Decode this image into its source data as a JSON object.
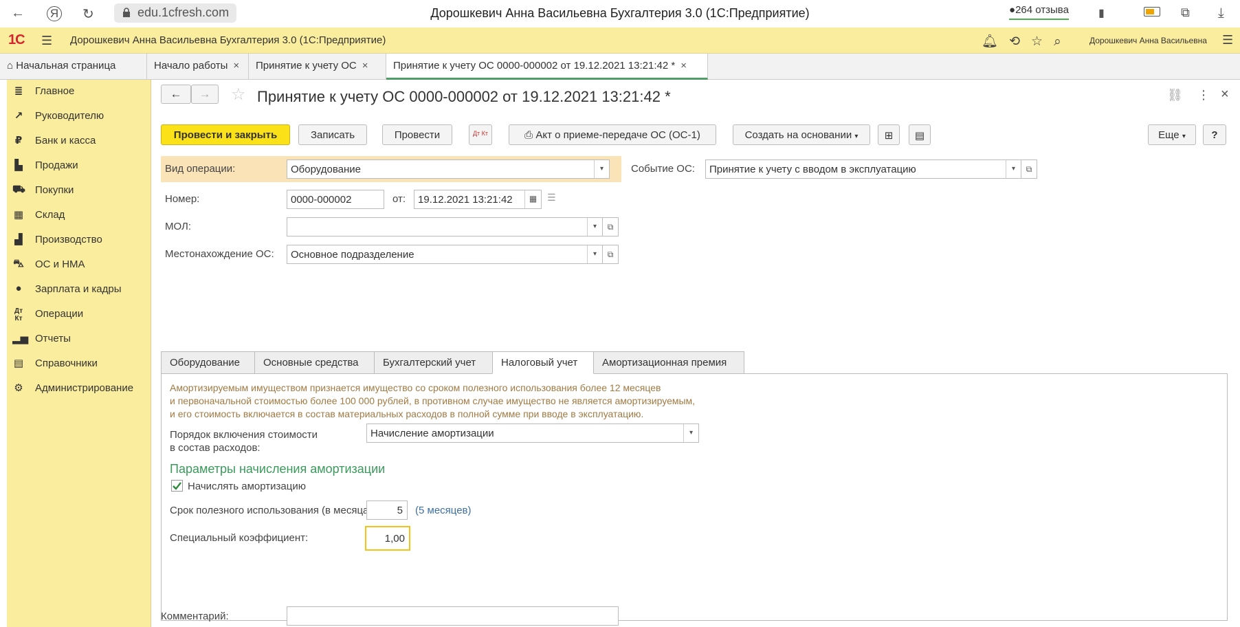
{
  "browser": {
    "url": "edu.1cfresh.com",
    "title": "Дорошкевич Анна Васильевна Бухгалтерия 3.0 (1С:Предприятие)",
    "reviews": "264 отзыва"
  },
  "app": {
    "logo": "1С",
    "title": "Дорошкевич Анна Васильевна Бухгалтерия 3.0  (1С:Предприятие)",
    "user": "Дорошкевич Анна Васильевна"
  },
  "tabs": [
    {
      "label": "Начальная страница"
    },
    {
      "label": "Начало работы"
    },
    {
      "label": "Принятие к учету ОС"
    },
    {
      "label": "Принятие к учету ОС 0000-000002 от 19.12.2021 13:21:42 *"
    }
  ],
  "sidebar": {
    "items": [
      {
        "label": "Главное"
      },
      {
        "label": "Руководителю"
      },
      {
        "label": "Банк и касса"
      },
      {
        "label": "Продажи"
      },
      {
        "label": "Покупки"
      },
      {
        "label": "Склад"
      },
      {
        "label": "Производство"
      },
      {
        "label": "ОС и НМА"
      },
      {
        "label": "Зарплата и кадры"
      },
      {
        "label": "Операции"
      },
      {
        "label": "Отчеты"
      },
      {
        "label": "Справочники"
      },
      {
        "label": "Администрирование"
      }
    ]
  },
  "doc": {
    "title": "Принятие к учету ОС 0000-000002 от 19.12.2021 13:21:42 *",
    "toolbar": {
      "post_close": "Провести и закрыть",
      "save": "Записать",
      "post": "Провести",
      "dtkt": "Дт Кт",
      "act": "Акт о приеме-передаче ОС (ОС-1)",
      "create_based": "Создать на основании",
      "more": "Еще",
      "help": "?"
    },
    "op_type_label": "Вид операции:",
    "op_type_value": "Оборудование",
    "event_label": "Событие ОС:",
    "event_value": "Принятие к учету с вводом в эксплуатацию",
    "number_label": "Номер:",
    "number_value": "0000-000002",
    "date_label": "от:",
    "date_value": "19.12.2021 13:21:42",
    "mol_label": "МОЛ:",
    "mol_value": "",
    "location_label": "Местонахождение ОС:",
    "location_value": "Основное подразделение",
    "form_tabs": [
      {
        "label": "Оборудование"
      },
      {
        "label": "Основные средства"
      },
      {
        "label": "Бухгалтерский учет"
      },
      {
        "label": "Налоговый учет"
      },
      {
        "label": "Амортизационная премия"
      }
    ],
    "tax": {
      "note1": "Амортизируемым имуществом признается имущество со сроком полезного использования более 12 месяцев",
      "note2": "и первоначальной стоимостью более 100 000 рублей, в противном случае имущество не является амортизируемым,",
      "note3": "и его стоимость включается в состав материальных расходов в полной сумме при вводе в эксплуатацию.",
      "order_label1": "Порядок включения стоимости",
      "order_label2": "в состав расходов:",
      "order_value": "Начисление амортизации",
      "params_header": "Параметры начисления амортизации",
      "accrue_label": "Начислять амортизацию",
      "accrue_checked": true,
      "life_label": "Срок полезного использования (в месяцах):",
      "life_value": "5",
      "life_hint": "(5 месяцев)",
      "coef_label": "Специальный коэффициент:",
      "coef_value": "1,00"
    },
    "comment_label": "Комментарий:",
    "comment_value": ""
  },
  "colors": {
    "sidebar_bg": "#fbed9e",
    "primary_button": "#fbe117",
    "header_green": "#3a9a5b",
    "note_text": "#a17a43",
    "active_tab_line": "#4c9e64"
  }
}
